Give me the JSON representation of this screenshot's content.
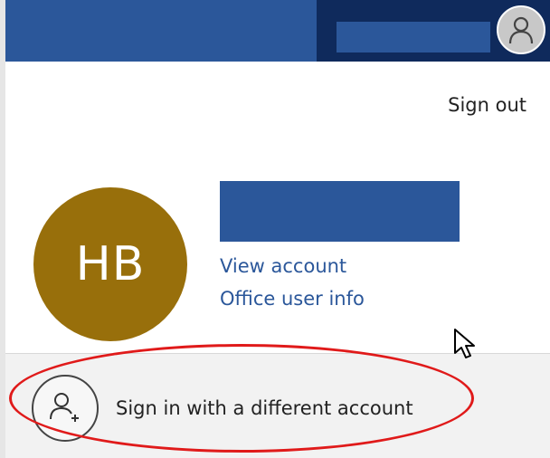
{
  "header": {
    "accent_color": "#2b579a",
    "dark_color": "#0f2a5c",
    "user_icon": "user-icon"
  },
  "account": {
    "sign_out_label": "Sign out",
    "initials": "HB",
    "avatar_color": "#986f0b",
    "view_account_label": "View account",
    "office_user_info_label": "Office user info"
  },
  "switch_account": {
    "label": "Sign in with a different account",
    "icon": "add-user-icon"
  },
  "annotation": {
    "color": "#e01a1a"
  }
}
